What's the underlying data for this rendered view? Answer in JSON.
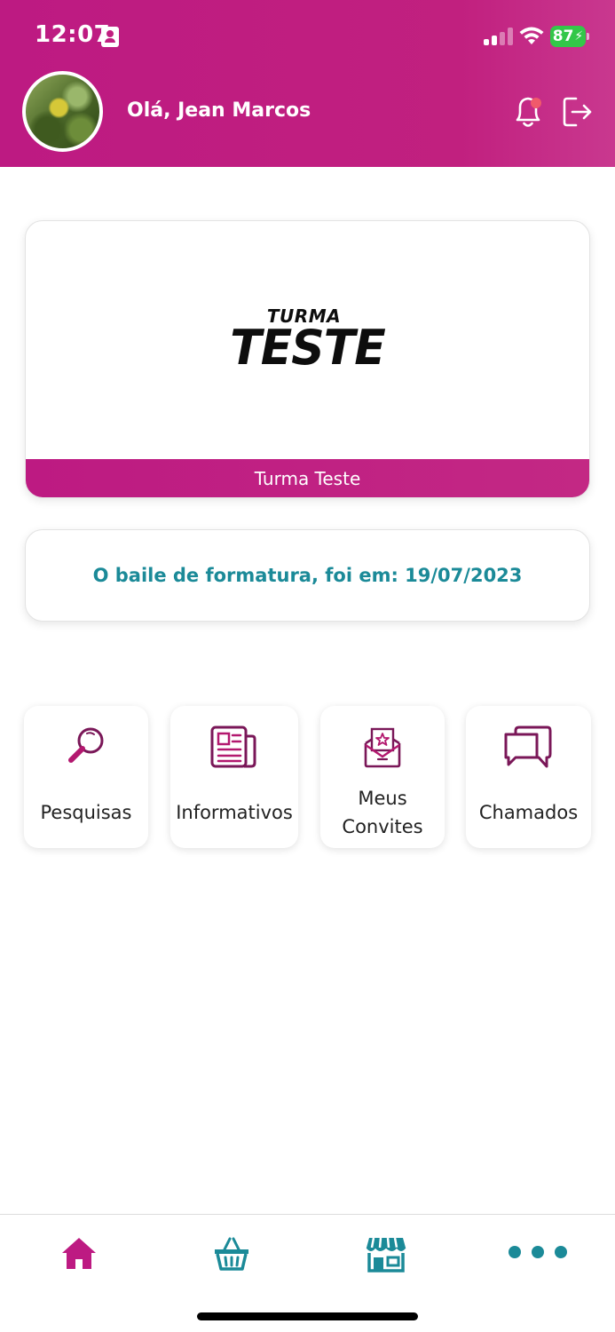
{
  "status_bar": {
    "time": "12:07",
    "battery": "87"
  },
  "header": {
    "greeting": "Olá, Jean Marcos",
    "notification_dot": true
  },
  "class_card": {
    "logo_small": "TURMA",
    "logo_big": "TESTE",
    "name": "Turma Teste"
  },
  "info": {
    "text": "O baile de formatura, foi em: 19/07/2023"
  },
  "menu": [
    {
      "label": "Pesquisas",
      "icon": "magnifier-icon"
    },
    {
      "label": "Informativos",
      "icon": "newspaper-icon"
    },
    {
      "label": "Meus Convites",
      "label_line1": "Meus",
      "label_line2": "Convites",
      "icon": "invitation-envelope-icon"
    },
    {
      "label": "Chamados",
      "icon": "chat-bubbles-icon"
    }
  ],
  "bottom_nav": {
    "items": [
      {
        "name": "home",
        "icon": "home-icon",
        "active": true
      },
      {
        "name": "basket",
        "icon": "basket-icon",
        "active": false
      },
      {
        "name": "store",
        "icon": "store-icon",
        "active": false
      },
      {
        "name": "more",
        "icon": "more-icon",
        "active": false
      }
    ]
  },
  "colors": {
    "brand": "#bd1a82",
    "accent_teal": "#1b8a98",
    "icon_dark": "#6b1450",
    "battery_green": "#33c749"
  }
}
